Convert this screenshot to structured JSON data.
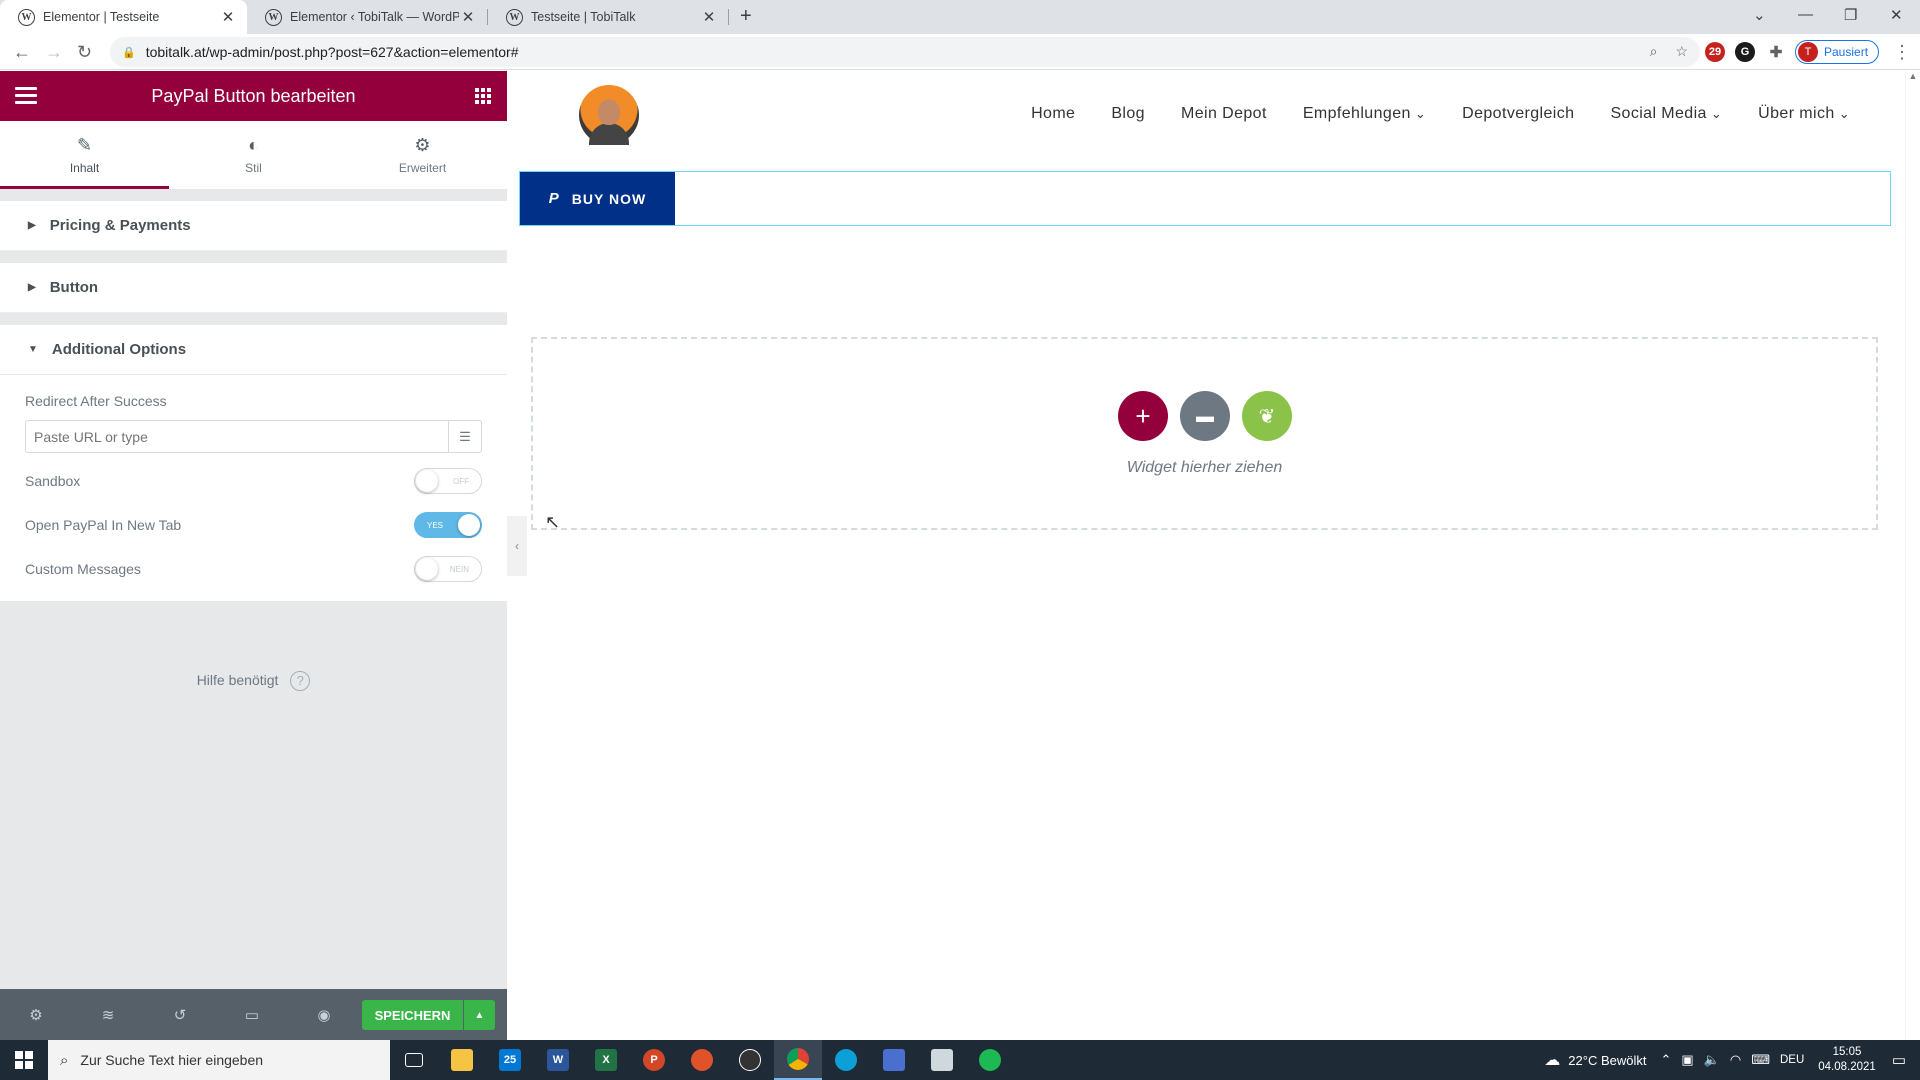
{
  "browser": {
    "tabs": [
      {
        "title": "Elementor | Testseite",
        "active": true
      },
      {
        "title": "Elementor ‹ TobiTalk — WordPre",
        "active": false
      },
      {
        "title": "Testseite | TobiTalk",
        "active": false
      }
    ],
    "url": "tobitalk.at/wp-admin/post.php?post=627&action=elementor#",
    "profile_initial": "T",
    "profile_label": "Pausiert",
    "ext_badge": "29"
  },
  "panel": {
    "title": "PayPal Button bearbeiten",
    "tabs": [
      {
        "label": "Inhalt",
        "icon": "pencil-icon",
        "active": true
      },
      {
        "label": "Stil",
        "icon": "contrast-icon",
        "active": false
      },
      {
        "label": "Erweitert",
        "icon": "gear-icon",
        "active": false
      }
    ],
    "sections": {
      "pricing": "Pricing & Payments",
      "button": "Button",
      "additional": "Additional Options"
    },
    "redirect_label": "Redirect After Success",
    "redirect_placeholder": "Paste URL or type",
    "sandbox_label": "Sandbox",
    "sandbox_state": "OFF",
    "newtab_label": "Open PayPal In New Tab",
    "newtab_state": "YES",
    "custom_label": "Custom Messages",
    "custom_state": "NEIN",
    "help": "Hilfe benötigt",
    "save": "SPEICHERN"
  },
  "site": {
    "nav": [
      "Home",
      "Blog",
      "Mein Depot",
      "Empfehlungen",
      "Depotvergleich",
      "Social Media",
      "Über mich"
    ],
    "buy_now": "BUY NOW",
    "dropzone_text": "Widget hierher ziehen"
  },
  "taskbar": {
    "search_placeholder": "Zur Suche Text hier eingeben",
    "weather": "22°C  Bewölkt",
    "lang": "DEU",
    "time": "15:05",
    "date": "04.08.2021",
    "mail_badge": "25"
  },
  "colors": {
    "elementor_brand": "#93003c",
    "paypal_blue": "#003087",
    "save_green": "#39b54a"
  }
}
